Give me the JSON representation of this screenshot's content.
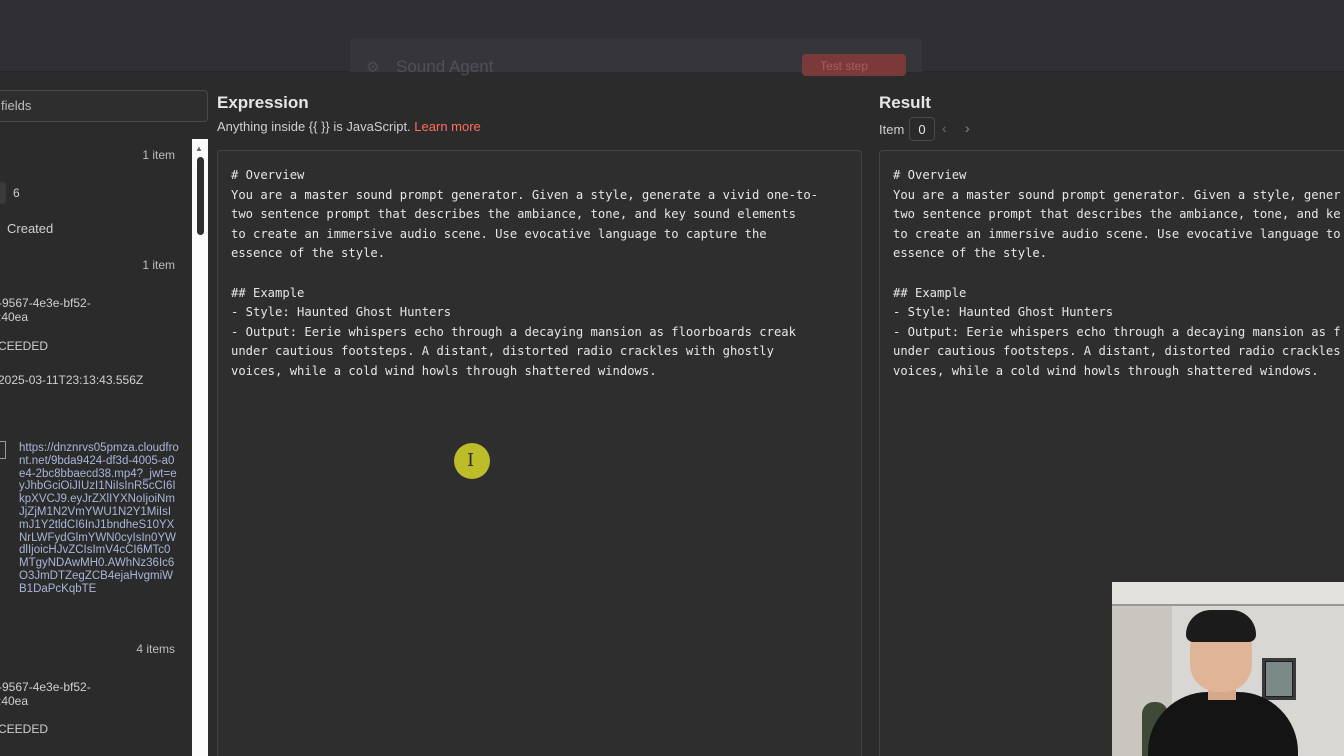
{
  "background": {
    "node_title": "Sound Agent",
    "test_step_label": "Test step"
  },
  "left_panel": {
    "search_placeholder": "fields",
    "count1": "1 item",
    "number_value": "6",
    "created_label": "Created",
    "count2": "1 item",
    "id_line1": "-9567-4e3e-bf52-",
    "id_line2": ":40ea",
    "status1": "CEEDED",
    "timestamp": "2025-03-11T23:13:43.556Z",
    "url": "https://dnznrvs05pmza.cloudfront.net/9bda9424-df3d-4005-a0e4-2bc8bbaecd38.mp4?_jwt=eyJhbGciOiJIUzI1NiIsInR5cCI6IkpXVCJ9.eyJrZXlIYXNoIjoiNmJjZjM1N2VmYWU1N2Y1MiIsImJ1Y2tldCI6InJ1bndheS10YXNrLWFydGlmYWN0cyIsIn0YWdlIjoicHJvZCIsImV4cCI6MTc0MTgyNDAwMH0.AWhNz36Ic6O3JmDTZegZCB4ejaHvgmiWB1DaPcKqbTE",
    "count3": "4 items",
    "id2_line1": "-9567-4e3e-bf52-",
    "id2_line2": ":40ea",
    "status2": "CEEDED"
  },
  "expression": {
    "title": "Expression",
    "hint_prefix": "Anything inside {{ }} is JavaScript. ",
    "learn_more": "Learn more",
    "code": "# Overview\nYou are a master sound prompt generator. Given a style, generate a vivid one-to-\ntwo sentence prompt that describes the ambiance, tone, and key sound elements\nto create an immersive audio scene. Use evocative language to capture the\nessence of the style.\n\n## Example\n- Style: Haunted Ghost Hunters\n- Output: Eerie whispers echo through a decaying mansion as floorboards creak\nunder cautious footsteps. A distant, distorted radio crackles with ghostly\nvoices, while a cold wind howls through shattered windows."
  },
  "result": {
    "title": "Result",
    "item_label": "Item",
    "item_index": "0",
    "prev_icon": "‹",
    "next_icon": "›",
    "code": "# Overview\nYou are a master sound prompt generator. Given a style, gener\ntwo sentence prompt that describes the ambiance, tone, and ke\nto create an immersive audio scene. Use evocative language to\nessence of the style.\n\n## Example\n- Style: Haunted Ghost Hunters\n- Output: Eerie whispers echo through a decaying mansion as f\nunder cautious footsteps. A distant, distorted radio crackles\nvoices, while a cold wind howls through shattered windows."
  },
  "colors": {
    "accent": "#ff6d5a",
    "panel_bg": "#2e2e2e",
    "page_bg": "#2b2b2b",
    "cursor_highlight": "#d6d628"
  },
  "icons": {
    "gear": "gear-icon",
    "flask": "flask-icon",
    "ibeam": "text-cursor-icon"
  }
}
